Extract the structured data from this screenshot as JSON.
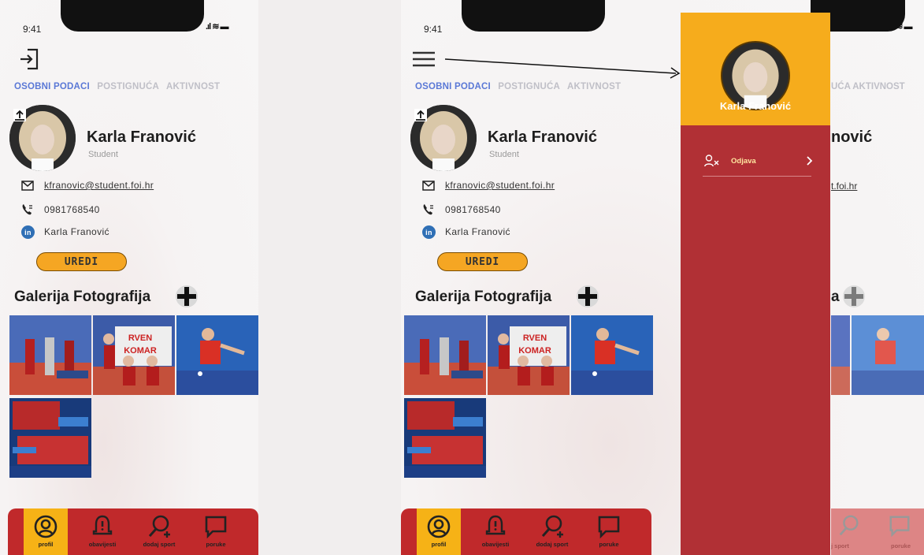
{
  "status": {
    "time": "9:41"
  },
  "tabs": [
    "OSOBNI PODACI",
    "POSTIGNUĆA",
    "AKTIVNOST"
  ],
  "profile": {
    "name": "Karla Franović",
    "role": "Student",
    "email": "kfranovic@student.foi.hr",
    "phone": "0981768540",
    "linkedin": "Karla Franović"
  },
  "edit_label": "UREDI",
  "gallery_title": "Galerija Fotografija",
  "nav": [
    {
      "label": "profil",
      "icon": "user-circle-icon"
    },
    {
      "label": "obavijesti",
      "icon": "bell-alert-icon"
    },
    {
      "label": "dodaj sport",
      "icon": "search-add-icon"
    },
    {
      "label": "poruke",
      "icon": "message-icon"
    }
  ],
  "drawer": {
    "name": "Karla Franović",
    "logout_label": "Odjava"
  },
  "peek": {
    "tab": "UĆA AKTIVNOST",
    "name": "nović",
    "email": "t.foi.hr",
    "gallery": "a",
    "nav1": "j sport",
    "nav2": "poruke"
  },
  "colors": {
    "accent": "#f6b216",
    "nav": "#c0292b",
    "drawer": "#b13035",
    "tab_active": "#5a78d6"
  }
}
